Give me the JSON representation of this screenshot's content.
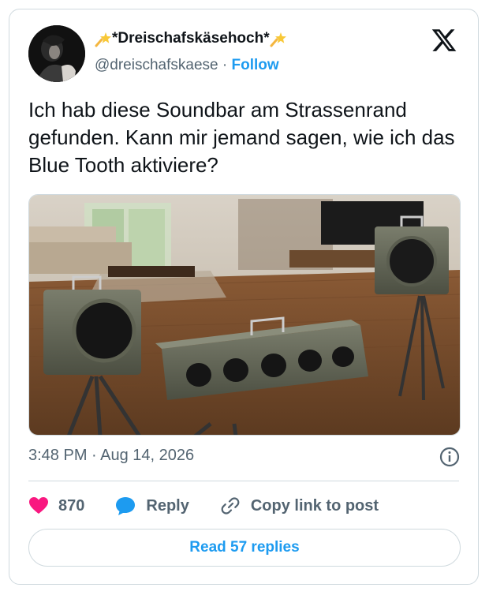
{
  "author": {
    "display_name": "*Dreischafskäsehoch*",
    "handle": "@dreischafskaese",
    "separator": "·",
    "follow_label": "Follow",
    "decoration_icon": "shooting-star-emoji"
  },
  "platform_logo": "x-logo-icon",
  "tweet": {
    "text": "Ich hab diese Soundbar am Strassenrand gefunden. Kann mir jemand sagen, wie ich das Blue Tooth aktiviere?"
  },
  "meta": {
    "timestamp": "3:48 PM · Aug 14, 2026"
  },
  "actions": {
    "like_count": "870",
    "reply_label": "Reply",
    "copy_label": "Copy link to post"
  },
  "read_replies_label": "Read 57 replies",
  "colors": {
    "accent": "#1d9bf0",
    "like": "#f91880",
    "muted": "#536471",
    "border": "#cfd9de"
  }
}
